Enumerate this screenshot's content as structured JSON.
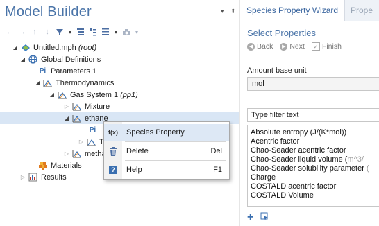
{
  "left_panel": {
    "title": "Model Builder",
    "controls": {
      "menu_arrow": "▾",
      "pin": "⬍"
    }
  },
  "tree": {
    "root": {
      "label": "Untitled.mph",
      "suffix": "(root)"
    },
    "global_definitions": "Global Definitions",
    "parameters": {
      "icon_text": "Pi",
      "label": "Parameters 1"
    },
    "thermodynamics": "Thermodynamics",
    "gas_system": {
      "label": "Gas System 1",
      "suffix": "(pp1)"
    },
    "mixture": "Mixture",
    "ethane": "ethane",
    "child_p": {
      "icon_text": "Pi"
    },
    "child_t": {
      "label": "T"
    },
    "methane": "methane",
    "materials": "Materials",
    "results": "Results"
  },
  "context_menu": {
    "items": [
      {
        "icon_text": "f(x)",
        "label": "Species Property",
        "shortcut": ""
      },
      {
        "icon_text": "",
        "label": "Delete",
        "shortcut": "Del"
      },
      {
        "icon_text": "?",
        "label": "Help",
        "shortcut": "F1"
      }
    ]
  },
  "right_panel": {
    "tab_active": "Species Property Wizard",
    "tab_inactive": "Prope",
    "section_title": "Select Properties",
    "wizard_nav": {
      "back": "Back",
      "next": "Next",
      "finish": "Finish"
    },
    "amount_base_unit": {
      "label": "Amount base unit",
      "value": "mol"
    },
    "filter_text": "Type filter text",
    "properties": [
      {
        "main": "Absolute entropy (J/(K*mol))",
        "dim": ""
      },
      {
        "main": "Acentric factor",
        "dim": ""
      },
      {
        "main": "Chao-Seader acentric factor",
        "dim": ""
      },
      {
        "main": "Chao-Seader liquid volume (",
        "dim": "m^3/"
      },
      {
        "main": "Chao-Seader solubility parameter",
        "dim": " ("
      },
      {
        "main": "Charge",
        "dim": ""
      },
      {
        "main": "COSTALD acentric factor",
        "dim": ""
      },
      {
        "main": "COSTALD Volume",
        "dim": ""
      }
    ]
  },
  "colors": {
    "accent": "#4a74a8",
    "selection": "#d9e6f5"
  }
}
